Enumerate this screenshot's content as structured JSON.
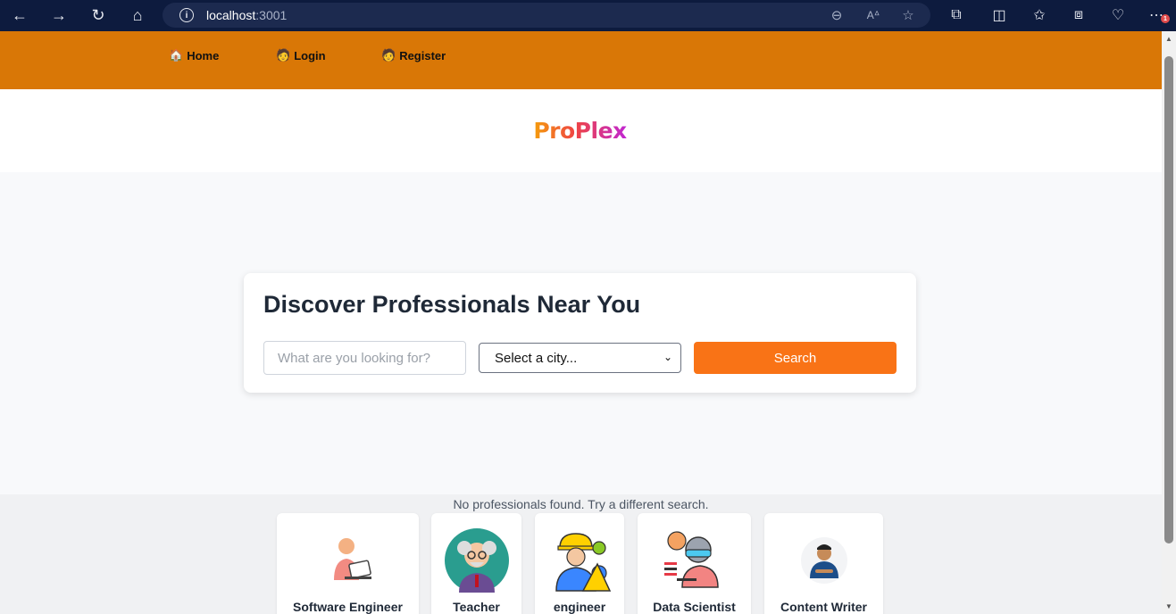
{
  "browser": {
    "url_host": "localhost",
    "url_port": ":3001",
    "notification_badge": "1"
  },
  "nav": {
    "items": [
      {
        "emoji": "🏠",
        "label": "Home"
      },
      {
        "emoji": "🧑",
        "label": "Login"
      },
      {
        "emoji": "🧑",
        "label": "Register"
      }
    ]
  },
  "brand": {
    "logo_text": "ProPlex",
    "gradient": [
      "#f59e0b",
      "#ef4444",
      "#c026d3"
    ]
  },
  "search": {
    "heading": "Discover Professionals Near You",
    "query_placeholder": "What are you looking for?",
    "city_selected": "Select a city...",
    "button_label": "Search"
  },
  "results": {
    "empty_message": "No professionals found. Try a different search.",
    "categories": [
      {
        "label": "Software Engineer",
        "icon": "software-engineer-illustration"
      },
      {
        "label": "Teacher",
        "icon": "teacher-illustration"
      },
      {
        "label": "engineer",
        "icon": "engineer-illustration"
      },
      {
        "label": "Data Scientist",
        "icon": "data-scientist-illustration"
      },
      {
        "label": "Content Writer",
        "icon": "content-writer-illustration"
      }
    ]
  },
  "colors": {
    "nav_bg": "#d97706",
    "accent": "#f97316",
    "chrome_bg": "#0d1b3e"
  }
}
